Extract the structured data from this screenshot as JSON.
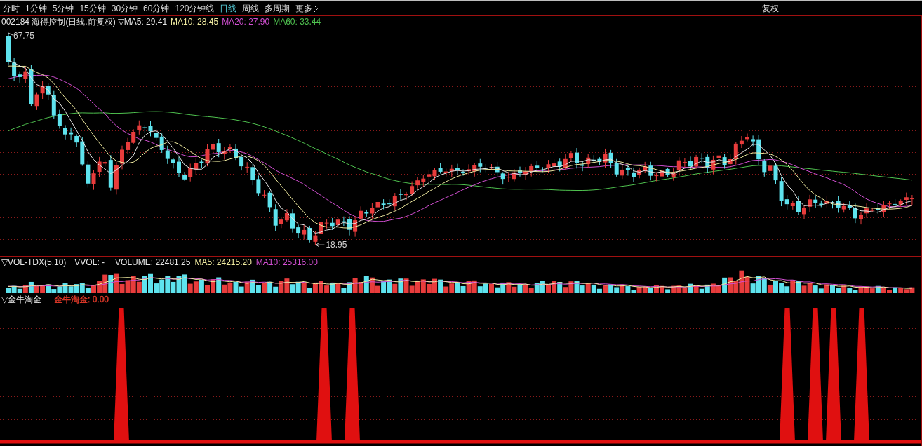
{
  "toolbar": {
    "tabs": [
      {
        "label": "分时",
        "kind": "tab",
        "selected": false
      },
      {
        "label": "1分钟",
        "kind": "tab",
        "selected": false
      },
      {
        "label": "5分钟",
        "kind": "tab",
        "selected": false
      },
      {
        "label": "15分钟",
        "kind": "tab",
        "selected": false
      },
      {
        "label": "30分钟",
        "kind": "tab",
        "selected": false
      },
      {
        "label": "60分钟",
        "kind": "tab",
        "selected": false
      },
      {
        "label": "120分钟线",
        "kind": "tab",
        "selected": false
      },
      {
        "label": "日线",
        "kind": "tab",
        "selected": true
      },
      {
        "label": "周线",
        "kind": "tab",
        "selected": false
      },
      {
        "label": "多周期",
        "kind": "tab",
        "selected": false
      },
      {
        "label": "更多",
        "kind": "menu",
        "selected": false
      }
    ],
    "adjust_button": "复权"
  },
  "price_panel": {
    "title": "002184 海得控制(日线.前复权)",
    "marker": "▽",
    "readings": [
      {
        "label": "MA5: 29.41",
        "color": "#e6e6e6"
      },
      {
        "label": "MA10: 28.45",
        "color": "#f0eba0"
      },
      {
        "label": "MA20: 27.90",
        "color": "#d24fd2"
      },
      {
        "label": "MA60: 33.44",
        "color": "#4fc24f"
      }
    ],
    "high_label": "67.75",
    "low_label": "18.95"
  },
  "volume_panel": {
    "marker": "▽",
    "title": "VOL-TDX(5,10)",
    "sub_title": "VVOL: -",
    "readings": [
      {
        "label": "VOLUME: 22481.25",
        "color": "#e6e6e6"
      },
      {
        "label": "MA5: 24215.20",
        "color": "#f0eba0"
      },
      {
        "label": "MA10: 25316.00",
        "color": "#d24fd2"
      }
    ]
  },
  "signal_panel": {
    "marker": "▽",
    "title": "金牛淘金",
    "readings": [
      {
        "label": "金牛淘金: 0.00",
        "color": "#e23a2a"
      }
    ]
  }
}
